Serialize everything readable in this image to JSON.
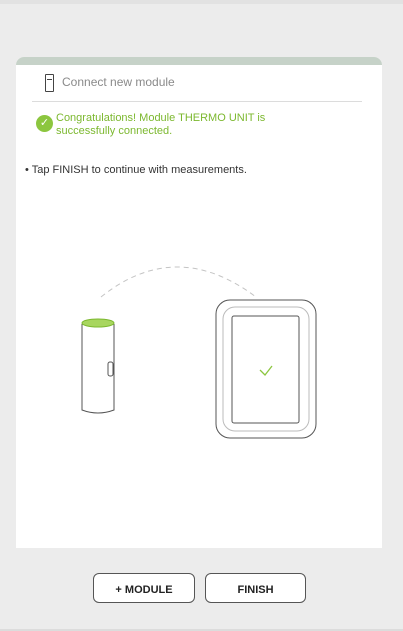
{
  "header": {
    "title": "Connect new module",
    "icon": "module-icon"
  },
  "status": {
    "icon": "check-circle-icon",
    "message": "Congratulations! Module THERMO UNIT is successfully connected.",
    "color": "#8cc63f"
  },
  "instruction": "• Tap FINISH to continue with measurements.",
  "illustration": {
    "module_icon": "thermo-module-icon",
    "station_icon": "base-station-icon",
    "check_icon": "check-icon"
  },
  "footer": {
    "add_module_label": "+ MODULE",
    "finish_label": "FINISH"
  }
}
